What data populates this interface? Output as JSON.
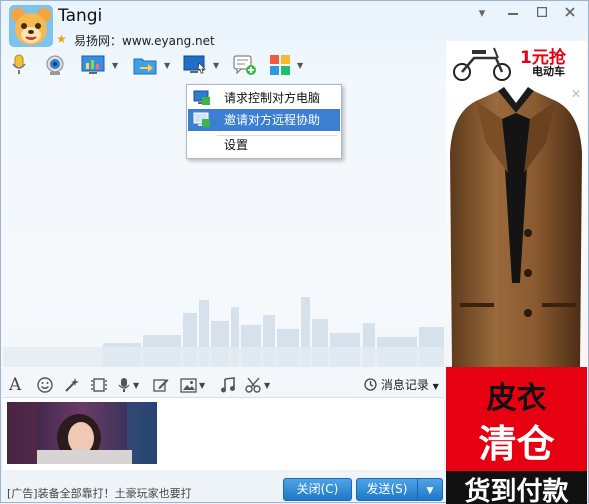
{
  "header": {
    "title": "Tangi",
    "subtitle": "易扬网：www.eyang.net"
  },
  "context_menu": {
    "items": [
      {
        "label": "请求控制对方电脑"
      },
      {
        "label": "邀请对方远程协助"
      },
      {
        "label": "设置"
      }
    ]
  },
  "input_toolbar": {
    "history_label": "消息记录"
  },
  "footer": {
    "ad_text": "[广告]装备全部靠打！土豪玩家也要打",
    "close_label": "关闭(C)",
    "send_label": "发送(S)"
  },
  "ad": {
    "top_price": "1元抢",
    "top_caption": "电动车",
    "headline_1": "皮衣",
    "headline_2": "清仓",
    "bottom_text": "货到付款"
  },
  "colors": {
    "menu_highlight": "#3c7fd2",
    "button_blue": "#1d78c7",
    "ad_red": "#e60012"
  }
}
